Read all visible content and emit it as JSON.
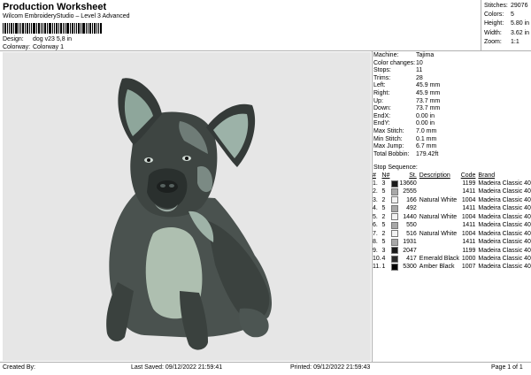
{
  "header": {
    "title": "Production Worksheet",
    "subtitle": "Wilcom EmbroideryStudio – Level 3 Advanced",
    "design_label": "Design:",
    "design_value": "dog v23 5,8 in",
    "colorway_label": "Colorway:",
    "colorway_value": "Colorway 1"
  },
  "summary": [
    {
      "label": "Stitches:",
      "value": "29076"
    },
    {
      "label": "Colors:",
      "value": "5"
    },
    {
      "label": "Height:",
      "value": "5.80 in"
    },
    {
      "label": "Width:",
      "value": "3.62 in"
    },
    {
      "label": "Zoom:",
      "value": "1:1"
    }
  ],
  "info": [
    {
      "label": "Machine:",
      "value": "Tajima"
    },
    {
      "label": "Color changes:",
      "value": "10"
    },
    {
      "label": "Stops:",
      "value": "11"
    },
    {
      "label": "Trims:",
      "value": "28"
    },
    {
      "label": "Left:",
      "value": "45.9 mm"
    },
    {
      "label": "Right:",
      "value": "45.9 mm"
    },
    {
      "label": "Up:",
      "value": "73.7 mm"
    },
    {
      "label": "Down:",
      "value": "73.7 mm"
    },
    {
      "label": "EndX:",
      "value": "0.00 in"
    },
    {
      "label": "EndY:",
      "value": "0.00 in"
    },
    {
      "label": "Max Stitch:",
      "value": "7.0 mm"
    },
    {
      "label": "Min Stitch:",
      "value": "0.1 mm"
    },
    {
      "label": "Max Jump:",
      "value": "6.7 mm"
    },
    {
      "label": "Total Bobbin:",
      "value": "179.42ft"
    }
  ],
  "stop_sequence": {
    "title": "Stop Sequence:",
    "headers": {
      "idx": "#",
      "n": "N#",
      "st": "St.",
      "desc": "Description",
      "code": "Code",
      "brand": "Brand"
    },
    "rows": [
      {
        "idx": "1.",
        "n": "3",
        "color": "#1a1a1a",
        "st": "13660",
        "desc": "",
        "code": "1199",
        "brand": "Madeira Classic 40"
      },
      {
        "idx": "2.",
        "n": "5",
        "color": "#a8a8a8",
        "st": "2555",
        "desc": "",
        "code": "1411",
        "brand": "Madeira Classic 40"
      },
      {
        "idx": "3.",
        "n": "2",
        "color": "#f2f2f2",
        "st": "166",
        "desc": "Natural White",
        "code": "1004",
        "brand": "Madeira Classic 40"
      },
      {
        "idx": "4.",
        "n": "5",
        "color": "#a8a8a8",
        "st": "492",
        "desc": "",
        "code": "1411",
        "brand": "Madeira Classic 40"
      },
      {
        "idx": "5.",
        "n": "2",
        "color": "#f2f2f2",
        "st": "1440",
        "desc": "Natural White",
        "code": "1004",
        "brand": "Madeira Classic 40"
      },
      {
        "idx": "6.",
        "n": "5",
        "color": "#a8a8a8",
        "st": "550",
        "desc": "",
        "code": "1411",
        "brand": "Madeira Classic 40"
      },
      {
        "idx": "7.",
        "n": "2",
        "color": "#f2f2f2",
        "st": "516",
        "desc": "Natural White",
        "code": "1004",
        "brand": "Madeira Classic 40"
      },
      {
        "idx": "8.",
        "n": "5",
        "color": "#a8a8a8",
        "st": "1931",
        "desc": "",
        "code": "1411",
        "brand": "Madeira Classic 40"
      },
      {
        "idx": "9.",
        "n": "3",
        "color": "#1a1a1a",
        "st": "2047",
        "desc": "",
        "code": "1199",
        "brand": "Madeira Classic 40"
      },
      {
        "idx": "10.",
        "n": "4",
        "color": "#2a2a2a",
        "st": "417",
        "desc": "Emerald Black",
        "code": "1000",
        "brand": "Madeira Classic 40"
      },
      {
        "idx": "11.",
        "n": "1",
        "color": "#000000",
        "st": "5300",
        "desc": "Amber Black",
        "code": "1007",
        "brand": "Madeira Classic 40"
      }
    ]
  },
  "footer": {
    "created_by": "Created By:",
    "last_saved": "Last Saved: 09/12/2022 21:59:41",
    "printed": "Printed: 09/12/2022 21:59:43",
    "page": "Page 1 of 1"
  },
  "design_image": {
    "subject": "french-bulldog-embroidery",
    "background": "#e6e6e6"
  }
}
